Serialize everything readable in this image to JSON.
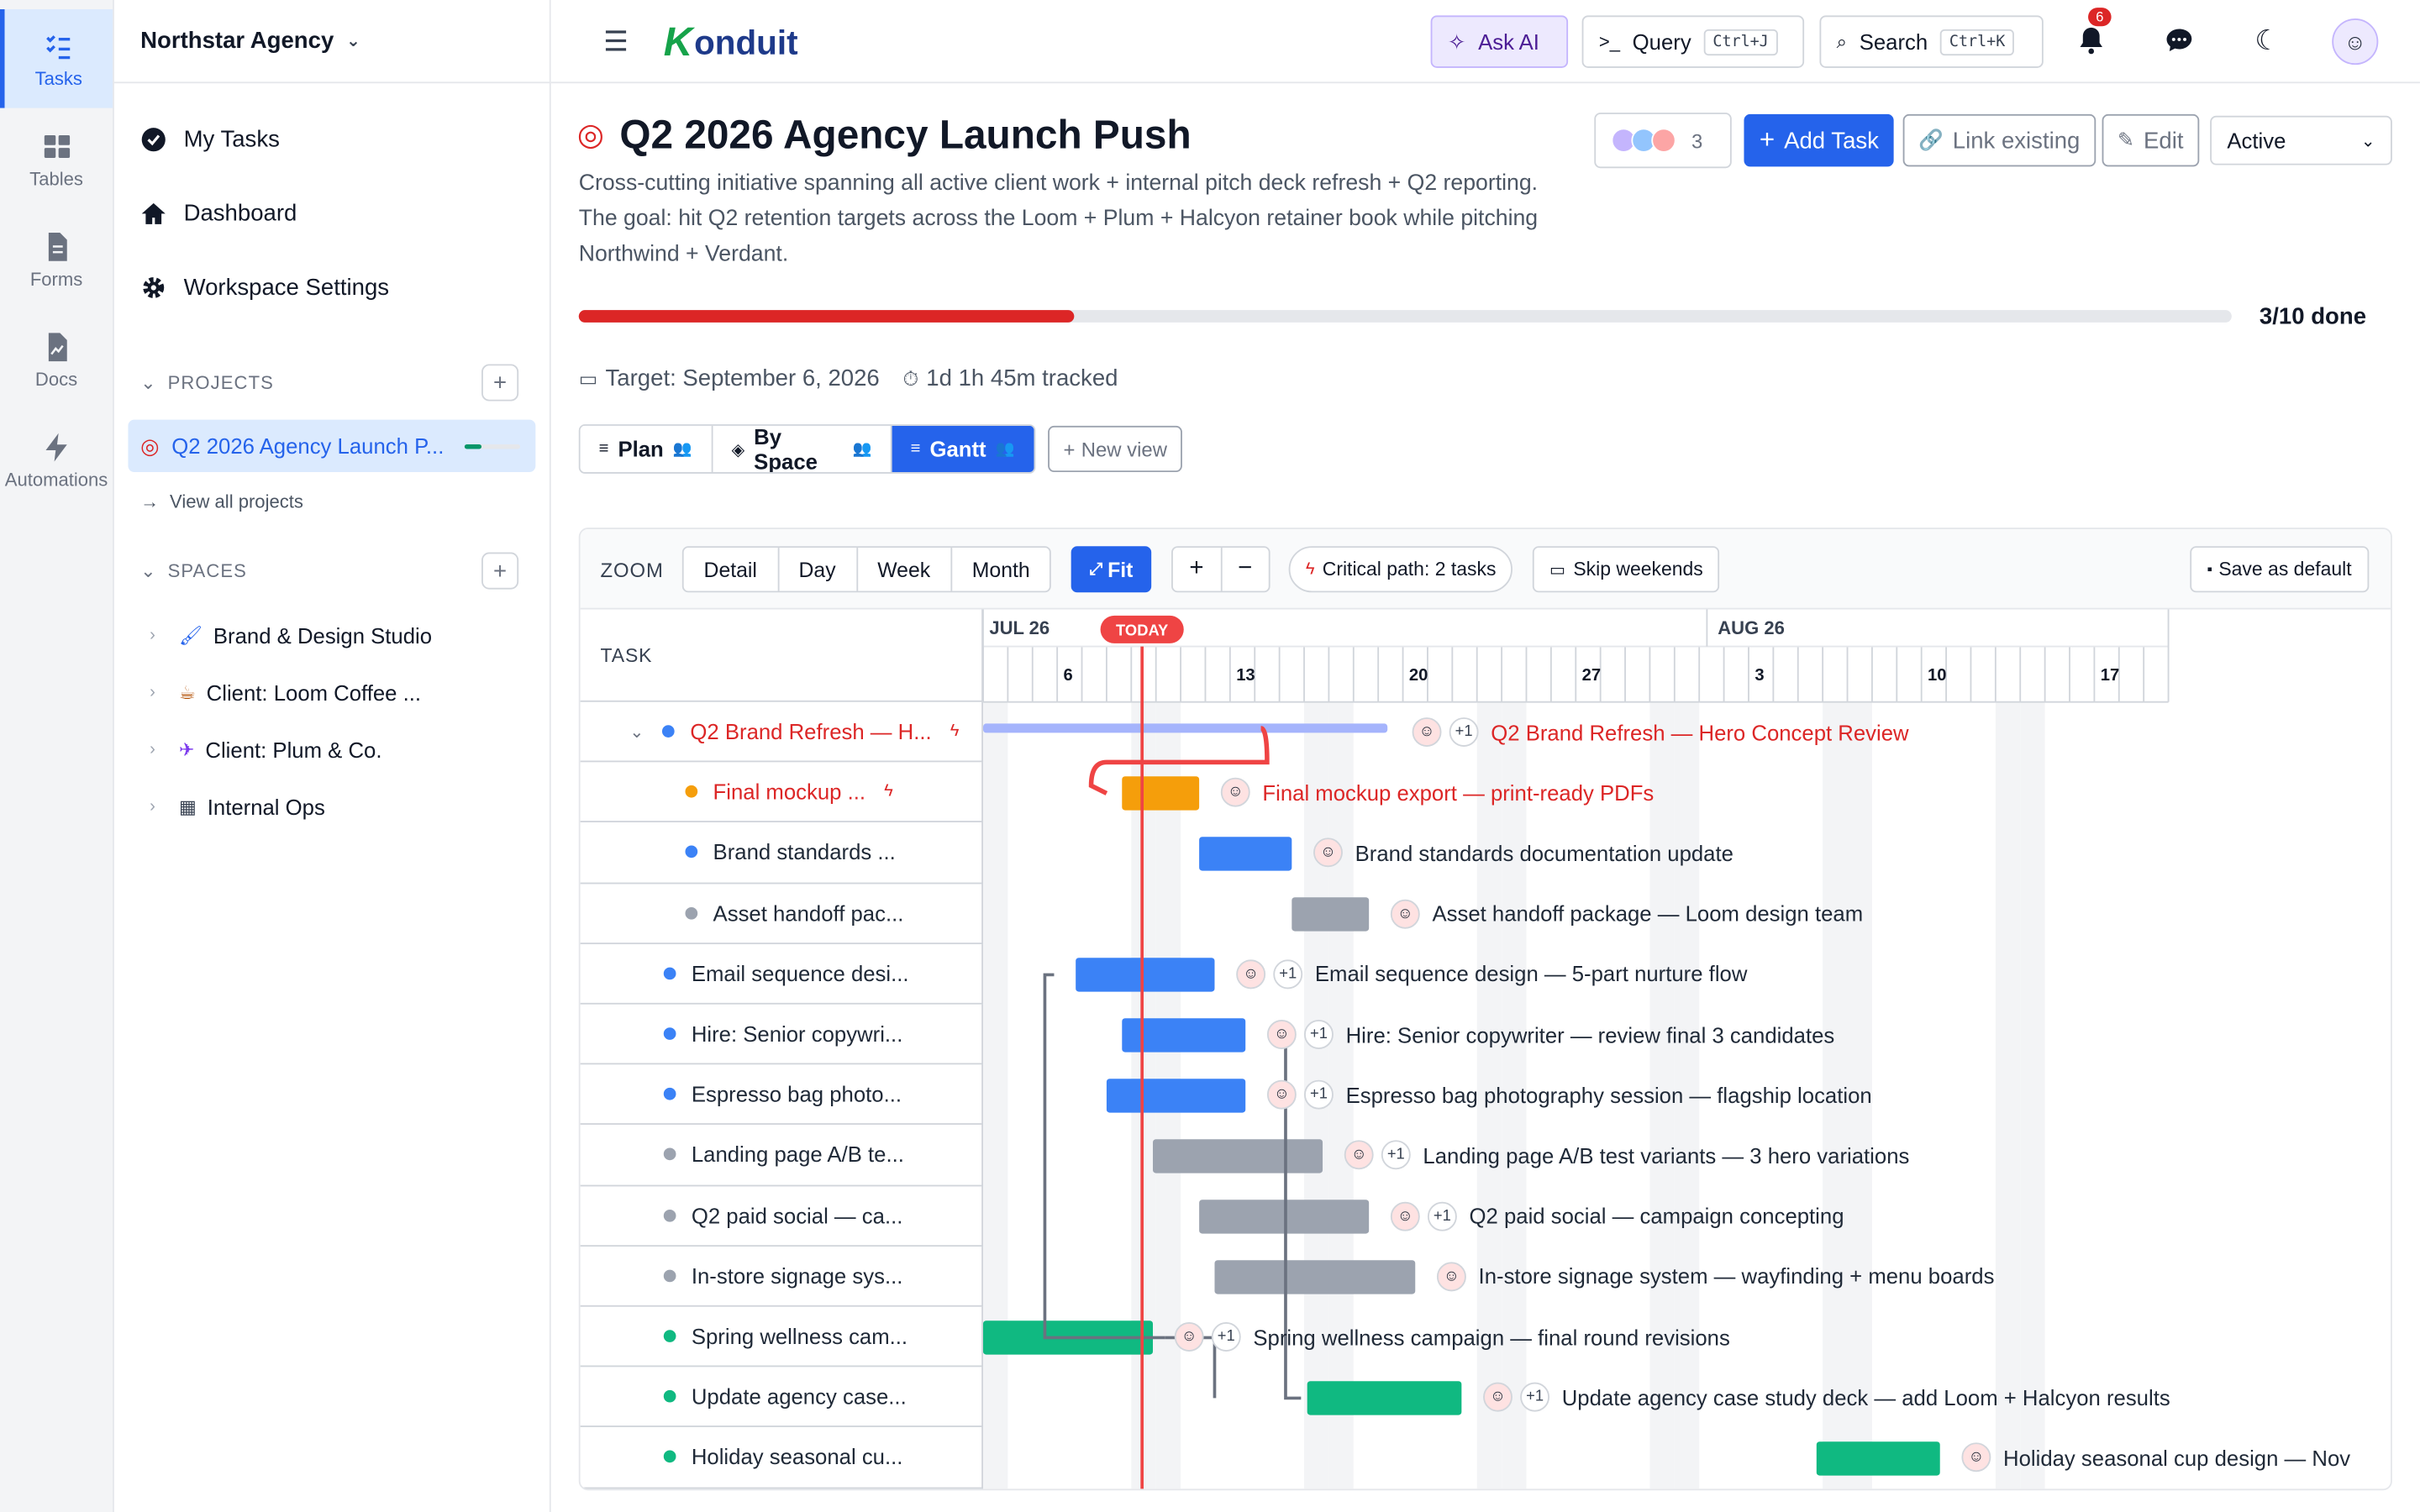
{
  "rail": [
    {
      "label": "Tasks",
      "icon": "tasks-icon",
      "active": true
    },
    {
      "label": "Tables",
      "icon": "table-icon"
    },
    {
      "label": "Forms",
      "icon": "form-icon"
    },
    {
      "label": "Docs",
      "icon": "doc-icon"
    },
    {
      "label": "Automations",
      "icon": "bolt-icon"
    }
  ],
  "sidebar": {
    "workspace": "Northstar Agency",
    "nav": [
      {
        "label": "My Tasks",
        "icon": "check-circle-icon"
      },
      {
        "label": "Dashboard",
        "icon": "home-icon"
      },
      {
        "label": "Workspace Settings",
        "icon": "gear-icon"
      }
    ],
    "projects_header": "PROJECTS",
    "active_project": "Q2 2026 Agency Launch P...",
    "active_project_progress": 0.3,
    "view_all": "View all projects",
    "spaces_header": "SPACES",
    "spaces": [
      {
        "label": "Brand & Design Studio",
        "icon": "🖌",
        "color": "#2563eb"
      },
      {
        "label": "Client: Loom Coffee ...",
        "icon": "☕",
        "color": "#b45309"
      },
      {
        "label": "Client: Plum & Co.",
        "icon": "✈",
        "color": "#7c3aed"
      },
      {
        "label": "Internal Ops",
        "icon": "▦",
        "color": "#374151"
      }
    ]
  },
  "topbar": {
    "logo": "onduit",
    "logo_k": "K",
    "ask_ai": "Ask AI",
    "query": "Query",
    "query_kbd": "Ctrl+J",
    "search": "Search",
    "search_kbd": "Ctrl+K",
    "notifications_count": "6"
  },
  "project": {
    "title": "Q2 2026 Agency Launch Push",
    "description": "Cross-cutting initiative spanning all active client work + internal pitch deck refresh + Q2 reporting. The goal: hit Q2 retention targets across the Loom + Plum + Halcyon retainer book while pitching Northwind + Verdant.",
    "member_count": "3",
    "add_task": "Add Task",
    "link_existing": "Link existing",
    "edit": "Edit",
    "status": "Active",
    "progress": 0.3,
    "progress_text": "3/10 done",
    "target": "Target: September 6, 2026",
    "tracked": "1d 1h 45m tracked"
  },
  "views": [
    {
      "label": "Plan",
      "active": false
    },
    {
      "label": "By Space",
      "active": false
    },
    {
      "label": "Gantt",
      "active": true
    }
  ],
  "new_view": "New view",
  "gantt": {
    "zoom_label": "ZOOM",
    "zoom_options": [
      "Detail",
      "Day",
      "Week",
      "Month"
    ],
    "fit": "Fit",
    "critical_path": "Critical path: 2 tasks",
    "skip_weekends": "Skip weekends",
    "save_default": "Save as default",
    "task_header": "TASK",
    "months": [
      {
        "label": "JUL 26"
      },
      {
        "label": "AUG 26"
      }
    ],
    "week_labels": [
      "6",
      "13",
      "20",
      "27",
      "3",
      "10",
      "17"
    ],
    "today": "TODAY",
    "tasks": [
      {
        "short": "Q2 Brand Refresh — H...",
        "full": "Q2 Brand Refresh — Hero Concept Review",
        "color": "#3b82f6",
        "critical": true,
        "indent": 0,
        "group": true,
        "start": 0,
        "end": 25,
        "plus1": true
      },
      {
        "short": "Final mockup ...",
        "full": "Final mockup export — print-ready PDFs",
        "color": "#f59e0b",
        "critical": true,
        "indent": 1,
        "start": 9,
        "end": 14,
        "plus1": false
      },
      {
        "short": "Brand standards ...",
        "full": "Brand standards documentation update",
        "color": "#3b82f6",
        "indent": 1,
        "start": 14,
        "end": 20,
        "plus1": false
      },
      {
        "short": "Asset handoff pac...",
        "full": "Asset handoff package — Loom design team",
        "color": "#9ca3af",
        "indent": 1,
        "start": 20,
        "end": 25,
        "plus1": false
      },
      {
        "short": "Email sequence desi...",
        "full": "Email sequence design — 5-part nurture flow",
        "color": "#3b82f6",
        "indent": 0,
        "start": 6,
        "end": 15,
        "plus1": true
      },
      {
        "short": "Hire: Senior copywri...",
        "full": "Hire: Senior copywriter — review final 3 candidates",
        "color": "#3b82f6",
        "indent": 0,
        "start": 9,
        "end": 17,
        "plus1": true
      },
      {
        "short": "Espresso bag photo...",
        "full": "Espresso bag photography session — flagship location",
        "color": "#3b82f6",
        "indent": 0,
        "start": 8,
        "end": 17,
        "plus1": true
      },
      {
        "short": "Landing page A/B te...",
        "full": "Landing page A/B test variants — 3 hero variations",
        "color": "#9ca3af",
        "indent": 0,
        "start": 11,
        "end": 22,
        "plus1": true
      },
      {
        "short": "Q2 paid social — ca...",
        "full": "Q2 paid social — campaign concepting",
        "color": "#9ca3af",
        "indent": 0,
        "start": 14,
        "end": 25,
        "plus1": true
      },
      {
        "short": "In-store signage sys...",
        "full": "In-store signage system — wayfinding + menu boards",
        "color": "#9ca3af",
        "indent": 0,
        "start": 15,
        "end": 28,
        "plus1": false
      },
      {
        "short": "Spring wellness cam...",
        "full": "Spring wellness campaign — final round revisions",
        "color": "#10b981",
        "indent": 0,
        "start": 0,
        "end": 11,
        "plus1": true
      },
      {
        "short": "Update agency case...",
        "full": "Update agency case study deck — add Loom + Halcyon results",
        "color": "#10b981",
        "indent": 0,
        "start": 21,
        "end": 31,
        "plus1": true
      },
      {
        "short": "Holiday seasonal cu...",
        "full": "Holiday seasonal cup design — Nov",
        "color": "#10b981",
        "indent": 0,
        "start": 54,
        "end": 62,
        "plus1": false
      }
    ]
  }
}
